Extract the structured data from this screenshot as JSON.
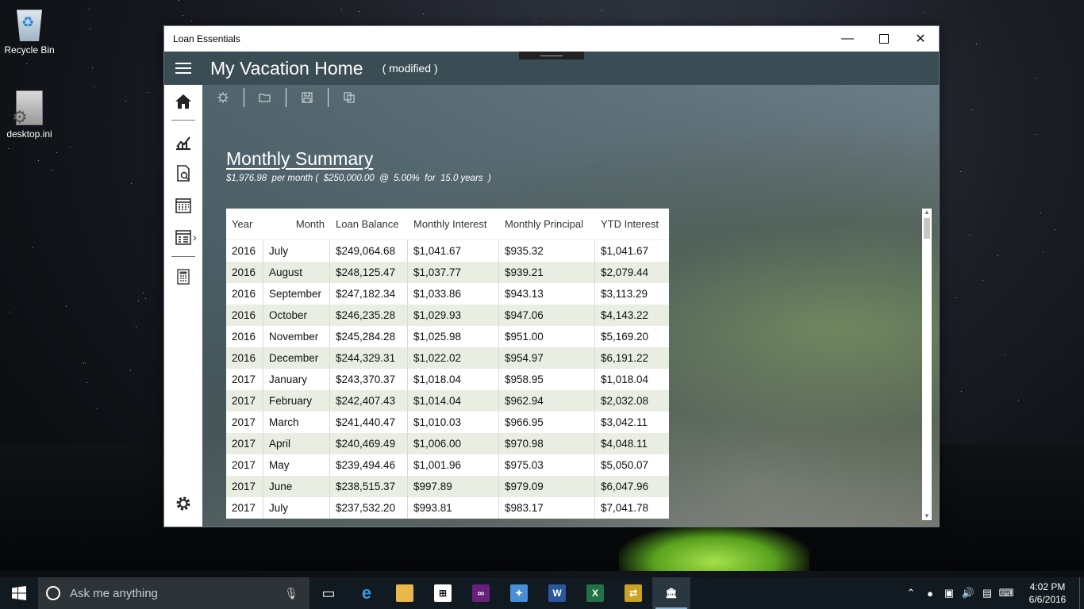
{
  "desktop": {
    "icons": [
      {
        "label": "Recycle Bin"
      },
      {
        "label": "desktop.ini"
      }
    ]
  },
  "window": {
    "title": "Loan Essentials",
    "controls": {
      "minimize": "—",
      "maximize": "",
      "close": "✕"
    }
  },
  "header": {
    "document_title": "My Vacation Home",
    "status": "( modified )"
  },
  "sidebar": {
    "items": [
      {
        "name": "home"
      },
      {
        "name": "charts"
      },
      {
        "name": "document-search"
      },
      {
        "name": "calendar"
      },
      {
        "name": "calendar-schedule"
      },
      {
        "name": "calculator"
      }
    ],
    "settings_icon": "gear"
  },
  "toolbar": {
    "items": [
      "new",
      "open",
      "save",
      "copy"
    ]
  },
  "summary": {
    "title": "Monthly Summary",
    "subtitle": "$1,976.98  per month (  $250,000.00  @  5.00%  for  15.0 years  )"
  },
  "table": {
    "columns": [
      "Year",
      "Month",
      "Loan Balance",
      "Monthly Interest",
      "Monthly Principal",
      "YTD Interest"
    ],
    "rows": [
      [
        "2016",
        "July",
        "$249,064.68",
        "$1,041.67",
        "$935.32",
        "$1,041.67"
      ],
      [
        "2016",
        "August",
        "$248,125.47",
        "$1,037.77",
        "$939.21",
        "$2,079.44"
      ],
      [
        "2016",
        "September",
        "$247,182.34",
        "$1,033.86",
        "$943.13",
        "$3,113.29"
      ],
      [
        "2016",
        "October",
        "$246,235.28",
        "$1,029.93",
        "$947.06",
        "$4,143.22"
      ],
      [
        "2016",
        "November",
        "$245,284.28",
        "$1,025.98",
        "$951.00",
        "$5,169.20"
      ],
      [
        "2016",
        "December",
        "$244,329.31",
        "$1,022.02",
        "$954.97",
        "$6,191.22"
      ],
      [
        "2017",
        "January",
        "$243,370.37",
        "$1,018.04",
        "$958.95",
        "$1,018.04"
      ],
      [
        "2017",
        "February",
        "$242,407.43",
        "$1,014.04",
        "$962.94",
        "$2,032.08"
      ],
      [
        "2017",
        "March",
        "$241,440.47",
        "$1,010.03",
        "$966.95",
        "$3,042.11"
      ],
      [
        "2017",
        "April",
        "$240,469.49",
        "$1,006.00",
        "$970.98",
        "$4,048.11"
      ],
      [
        "2017",
        "May",
        "$239,494.46",
        "$1,001.96",
        "$975.03",
        "$5,050.07"
      ],
      [
        "2017",
        "June",
        "$238,515.37",
        "$997.89",
        "$979.09",
        "$6,047.96"
      ],
      [
        "2017",
        "July",
        "$237,532.20",
        "$993.81",
        "$983.17",
        "$7,041.78"
      ]
    ]
  },
  "taskbar": {
    "search_placeholder": "Ask me anything",
    "apps": [
      "task-view",
      "edge",
      "file-explorer",
      "store",
      "visual-studio",
      "app-photos",
      "word",
      "excel",
      "app-misc",
      "loan-essentials"
    ],
    "clock": {
      "time": "4:02 PM",
      "date": "6/6/2016"
    }
  }
}
